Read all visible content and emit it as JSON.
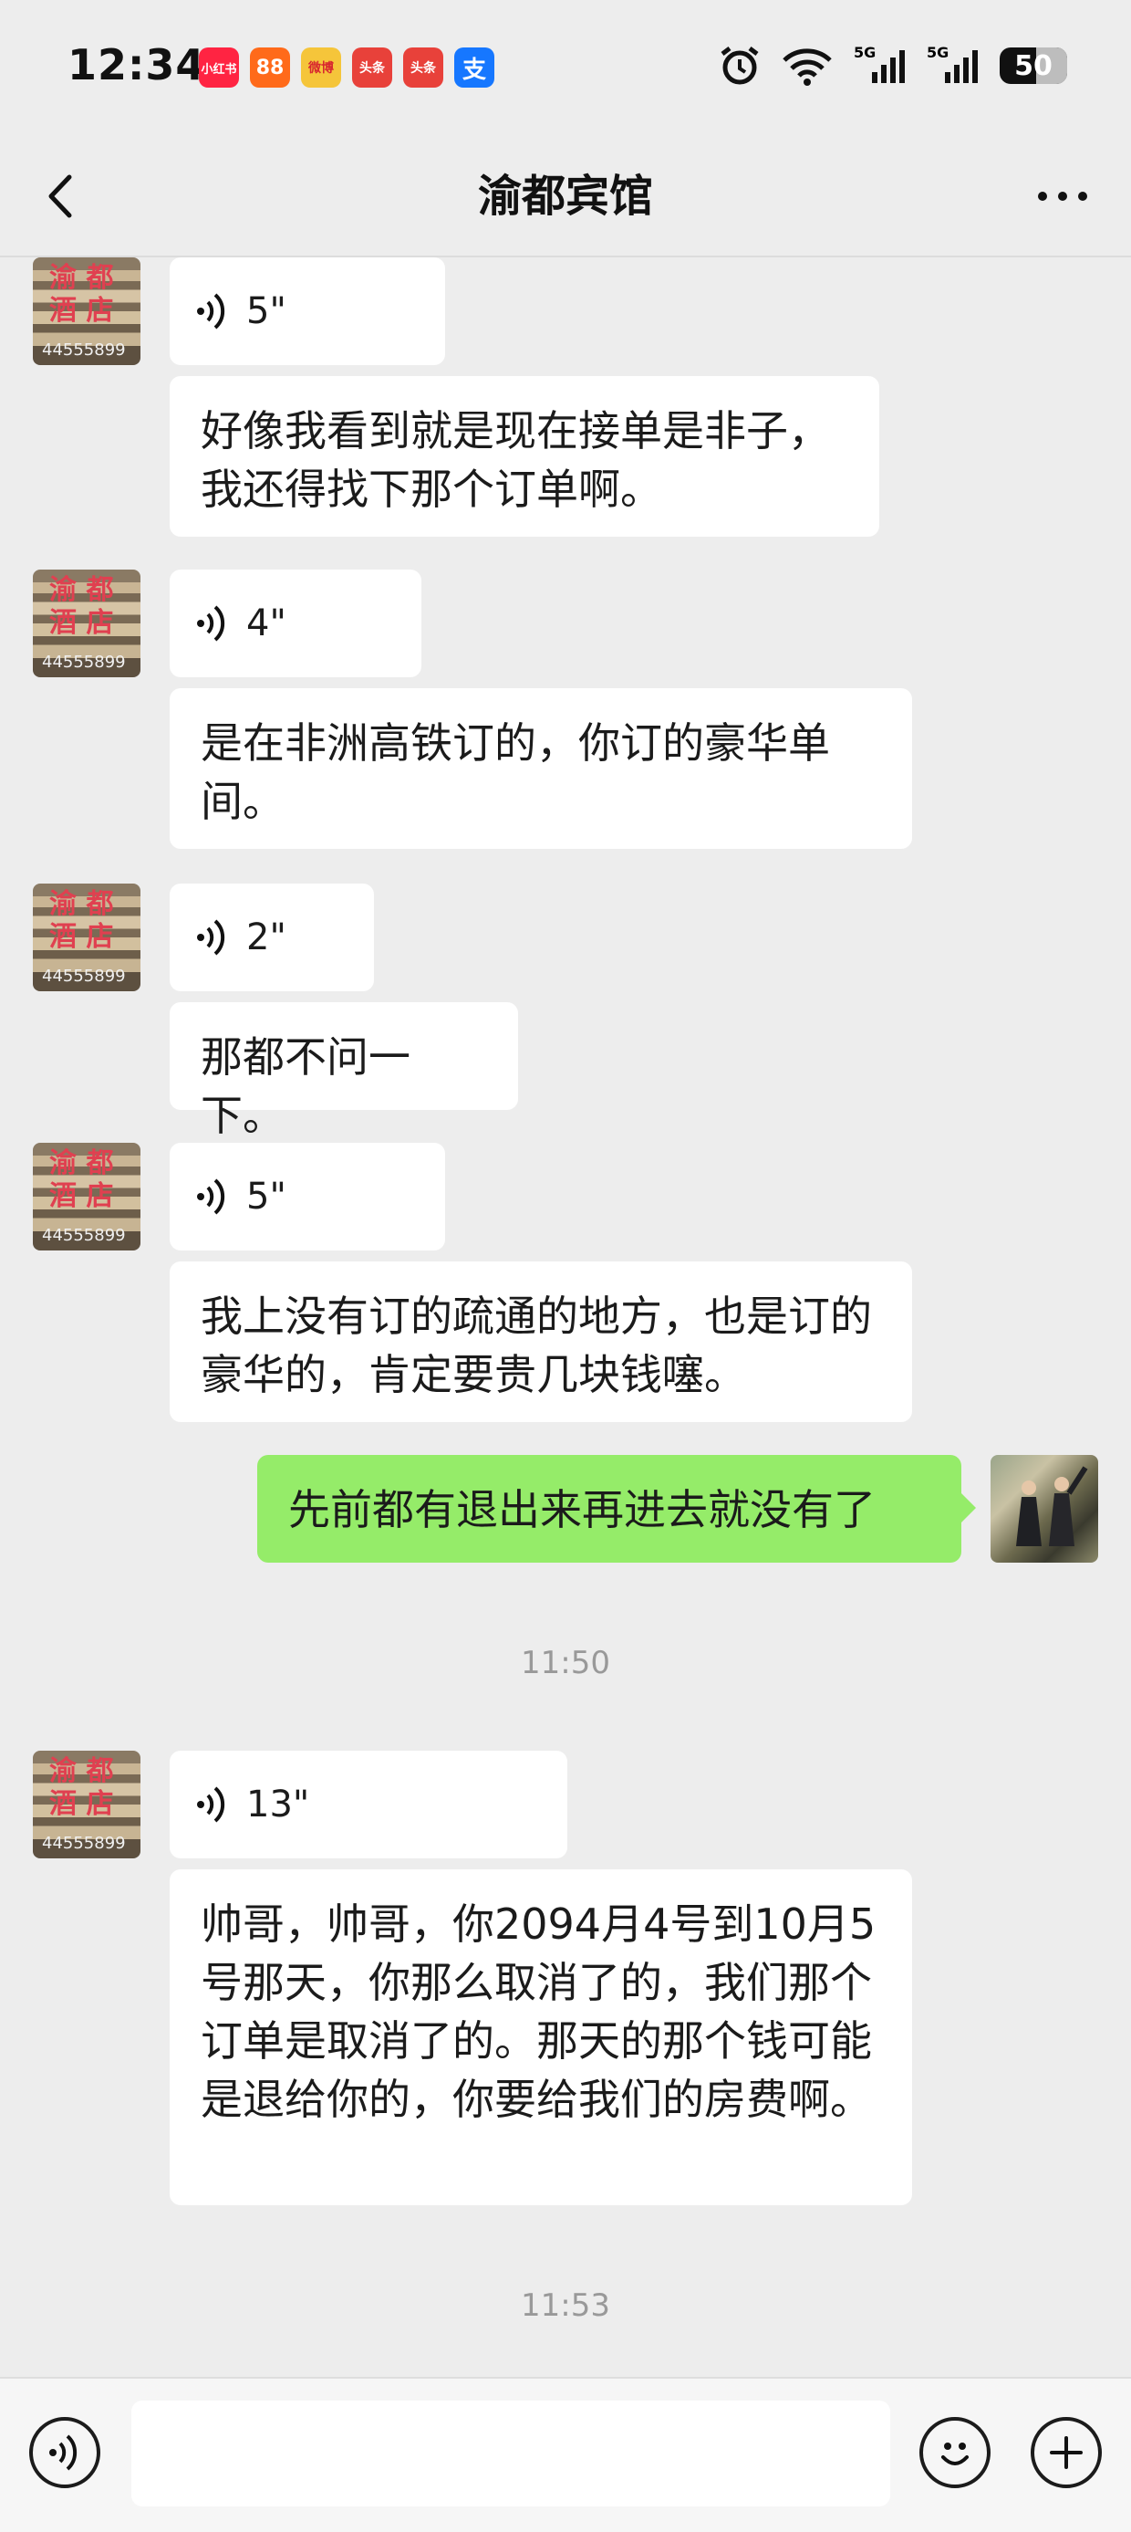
{
  "status_bar": {
    "time": "12:34",
    "apps": [
      {
        "label": "小红书",
        "color": "#ff2442",
        "icon": "xiaohongshu-icon"
      },
      {
        "label": "88",
        "color": "#ff6a1a",
        "icon": "kuaishou-icon"
      },
      {
        "label": "微博",
        "color": "#f5c53a",
        "icon": "weibo-icon"
      },
      {
        "label": "头条",
        "color": "#e8413a",
        "icon": "toutiao-icon"
      },
      {
        "label": "头条",
        "color": "#e8413a",
        "icon": "toutiao-lite-icon"
      },
      {
        "label": "支",
        "color": "#1677ff",
        "icon": "alipay-icon"
      }
    ],
    "signal_1": "5G",
    "signal_2": "5G",
    "battery": "50"
  },
  "header": {
    "title": "渝都宾馆"
  },
  "contact_avatar": {
    "sign_top": "渝 都",
    "sign_bottom": "酒 店",
    "phone": "44555899"
  },
  "messages": [
    {
      "type": "voice",
      "duration": "5\""
    },
    {
      "type": "text",
      "text": "好像我看到就是现在接单是非子，我还得找下那个订单啊。"
    },
    {
      "type": "voice",
      "duration": "4\""
    },
    {
      "type": "text",
      "text": "是在非洲高铁订的，你订的豪华单间。"
    },
    {
      "type": "voice",
      "duration": "2\""
    },
    {
      "type": "text",
      "text": "那都不问一下。"
    },
    {
      "type": "voice",
      "duration": "5\""
    },
    {
      "type": "text",
      "text": "我上没有订的疏通的地方，也是订的豪华的，肯定要贵几块钱噻。"
    },
    {
      "type": "self_text",
      "text": "先前都有退出来再进去就没有了"
    },
    {
      "type": "time",
      "text": "11:50"
    },
    {
      "type": "voice",
      "duration": "13\""
    },
    {
      "type": "text",
      "text": "帅哥，帅哥，你2094月4号到10月5号那天，你那么取消了的，我们那个订单是取消了的。那天的那个钱可能是退给你的，你要给我们的房费啊。"
    },
    {
      "type": "time",
      "text": "11:53"
    }
  ],
  "input_bar": {
    "voice_button_icon": "voice-input-icon",
    "emoji_button_icon": "emoji-icon",
    "plus_button_icon": "plus-icon",
    "text_value": ""
  }
}
